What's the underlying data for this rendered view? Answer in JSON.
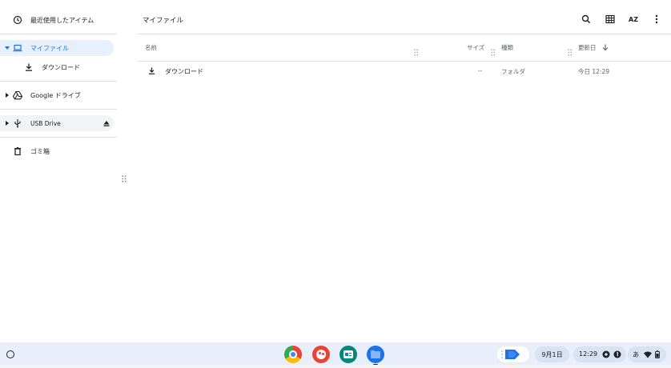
{
  "sidebar": {
    "recent_label": "最近使用したアイテム",
    "my_files_label": "マイファイル",
    "downloads_label": "ダウンロード",
    "google_drive_label": "Google ドライブ",
    "usb_label": "USB Drive",
    "trash_label": "ゴミ箱"
  },
  "header": {
    "title": "マイファイル",
    "sort_label": "AZ"
  },
  "table": {
    "columns": {
      "name": "名前",
      "size": "サイズ",
      "type": "種類",
      "modified": "更新日"
    },
    "rows": [
      {
        "name": "ダウンロード",
        "size": "--",
        "type": "フォルダ",
        "modified": "今日 12:29"
      }
    ]
  },
  "shelf": {
    "apps": [
      "chrome-icon",
      "paint-icon",
      "cursive-icon",
      "files-icon"
    ],
    "date": "9月1日",
    "time": "12:29",
    "ime": "あ",
    "colors": {
      "accent": "#1a73e8",
      "shelf_bg": "#e8effa"
    }
  }
}
